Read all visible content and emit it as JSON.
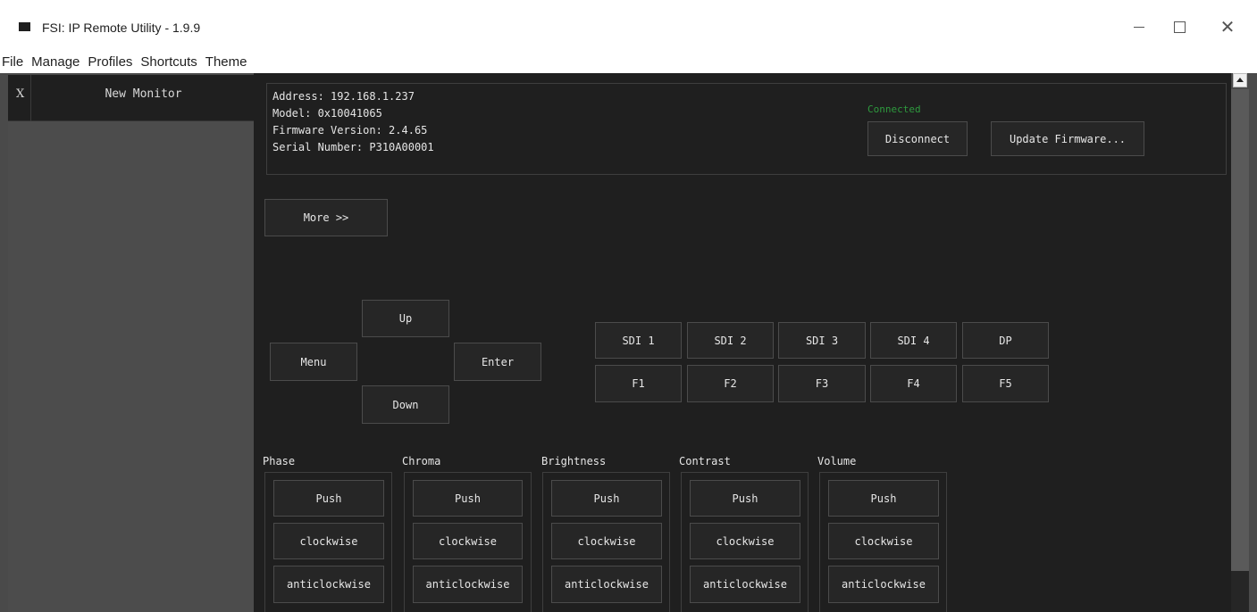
{
  "window": {
    "title": "FSI: IP Remote Utility - 1.9.9"
  },
  "menu": [
    "File",
    "Manage",
    "Profiles",
    "Shortcuts",
    "Theme"
  ],
  "sidebar": {
    "close_label": "X",
    "tab_label": "New Monitor"
  },
  "info": {
    "address": "Address: 192.168.1.237",
    "model": "Model: 0x10041065",
    "firmware": "Firmware Version: 2.4.65",
    "serial": "Serial Number: P310A00001",
    "status": "Connected",
    "status_color": "#2e9a3e",
    "disconnect_label": "Disconnect",
    "update_label": "Update Firmware..."
  },
  "more_label": "More  >>",
  "nav": {
    "up": "Up",
    "menu": "Menu",
    "enter": "Enter",
    "down": "Down"
  },
  "inputs": {
    "row1": [
      "SDI 1",
      "SDI 2",
      "SDI 3",
      "SDI 4",
      "DP"
    ],
    "row2": [
      "F1",
      "F2",
      "F3",
      "F4",
      "F5"
    ]
  },
  "knobs": [
    {
      "label": "Phase",
      "push": "Push",
      "cw": "clockwise",
      "ccw": "anticlockwise"
    },
    {
      "label": "Chroma",
      "push": "Push",
      "cw": "clockwise",
      "ccw": "anticlockwise"
    },
    {
      "label": "Brightness",
      "push": "Push",
      "cw": "clockwise",
      "ccw": "anticlockwise"
    },
    {
      "label": "Contrast",
      "push": "Push",
      "cw": "clockwise",
      "ccw": "anticlockwise"
    },
    {
      "label": "Volume",
      "push": "Push",
      "cw": "clockwise",
      "ccw": "anticlockwise"
    }
  ],
  "theme": {
    "background": "#1f1f1f",
    "sidebar": "#4c4c4c",
    "button": "#262626",
    "text": "#e6e6e6"
  }
}
